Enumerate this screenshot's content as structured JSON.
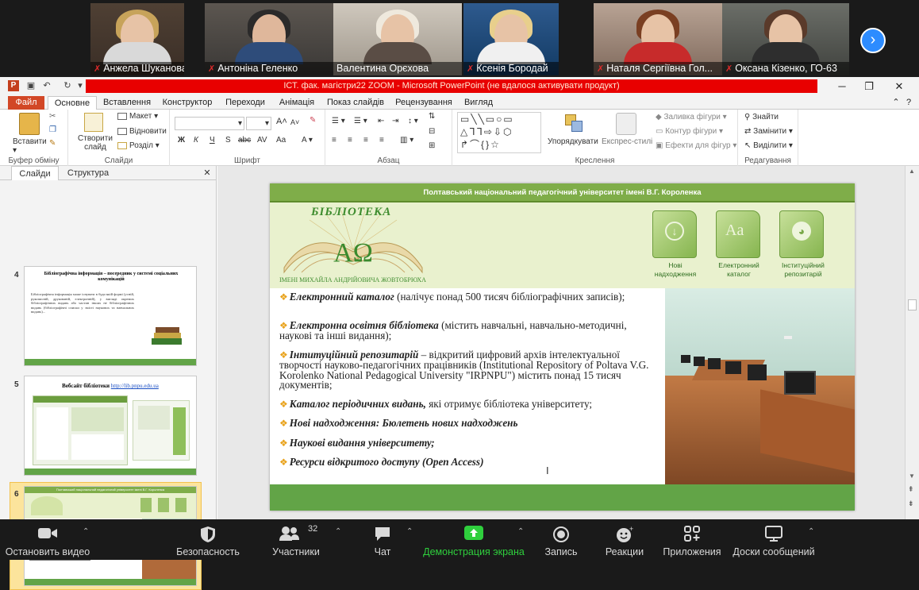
{
  "gallery": {
    "participants": [
      {
        "name": "Анжела Шуканова",
        "muted": true
      },
      {
        "name": "Антоніна Геленко",
        "muted": true
      },
      {
        "name": "Валентина Орєхова",
        "muted": false
      },
      {
        "name": "Ксенія Бородай",
        "muted": true
      },
      {
        "name": "Наталя Сергіївна Гол...",
        "muted": true
      },
      {
        "name": "Оксана Кізенко, ГО-63",
        "muted": true
      }
    ],
    "next_icon": "chevron-right-icon"
  },
  "powerpoint": {
    "window_title": "ІСТ. фак. магістри22 ZOOM  -  Microsoft PowerPoint (не вдалося активувати продукт)",
    "tabs": [
      "Файл",
      "Основне",
      "Вставлення",
      "Конструктор",
      "Переходи",
      "Анімація",
      "Показ слайдів",
      "Рецензування",
      "Вигляд"
    ],
    "groups": {
      "clipboard": {
        "name": "Буфер обміну",
        "paste": "Вставити"
      },
      "slides": {
        "name": "Слайди",
        "new_slide": "Створити слайд",
        "layout": "Макет",
        "reset": "Відновити",
        "section": "Розділ"
      },
      "font": {
        "name": "Шрифт"
      },
      "paragraph": {
        "name": "Абзац"
      },
      "drawing": {
        "name": "Креслення",
        "arrange": "Упорядкувати",
        "quick_styles": "Експрес-стилі",
        "fill": "Заливка фігури",
        "outline": "Контур фігури",
        "effects": "Ефекти для фігур"
      },
      "editing": {
        "name": "Редагування",
        "find": "Знайти",
        "replace": "Замінити",
        "select": "Виділити"
      }
    },
    "pane_tabs": [
      "Слайди",
      "Структура"
    ],
    "thumbnails": [
      {
        "num": "4",
        "title": "Бібліографічна інформація – посередник у системі соціальних комунікацій",
        "text": "Бібліографічна інформація може існувати в будь-якій формі (усній, рукописній, друкованій, електронній), у вигляді окремих бібліографічних видань або частин інших не бібліографічних видань (бібліографічні списки у змісті наукових та навчальних видань)..."
      },
      {
        "num": "5",
        "title": "Вебсайт бібліотеки",
        "link": "http://lib.pnpu.edu.ua"
      },
      {
        "num": "6",
        "title": "Полтавський національний педагогічний університет імені В.Г. Короленка"
      }
    ]
  },
  "slide": {
    "header": "Полтавський національний педагогічний університет імені В.Г. Короленка",
    "logo_word": "БІБЛІОТЕКА",
    "logo_caption": "ІМЕНІ МИХАЙЛА АНДРІЙОВИЧА ЖОВТОБРЮХА",
    "books": [
      {
        "label": "Нові надходження",
        "icon": "download-icon"
      },
      {
        "label": "Електронний каталог",
        "icon": "letters-icon"
      },
      {
        "label": "Інституційний репозитарій",
        "icon": "globe-icon"
      }
    ],
    "bullets": [
      {
        "bold": "Електронний каталог",
        "text": " (налічує понад 500 тисяч бібліографічних записів);"
      },
      {
        "bold": "Електронна освітня бібліотека",
        "text": " (містить навчальні, навчально-методичні, наукові та інші видання);"
      },
      {
        "bold": "Інтитуційний репозитарій",
        "text": " – відкритий цифровий архів інтелектуальної творчості науково-педагогічних працівників (Institutional Repository of Poltava V.G. Korolenko National Pedagogical University \"IRPNPU\") містить понад 15 тисяч документів;"
      },
      {
        "bold": "Каталог періодичних видань,",
        "text": " які отримує бібліотека університету;"
      },
      {
        "bold": "Нові надходження: Бюлетень нових надходжень",
        "text": ""
      },
      {
        "bold": "Наукові видання університету;",
        "text": ""
      },
      {
        "bold": "Ресурси відкритого доступу (Open Access)",
        "text": ""
      }
    ]
  },
  "toolbar": {
    "stop_video": "Остановить видео",
    "security": "Безопасность",
    "participants": "Участники",
    "participants_count": "32",
    "chat": "Чат",
    "share": "Демонстрация экрана",
    "record": "Запись",
    "reactions": "Реакции",
    "apps": "Приложения",
    "whiteboards": "Доски сообщений"
  },
  "colors": {
    "accent_green": "#2fcf3d",
    "zoom_blue": "#2d8cff",
    "ppt_orange": "#d24726",
    "slide_green": "#7fad49"
  }
}
